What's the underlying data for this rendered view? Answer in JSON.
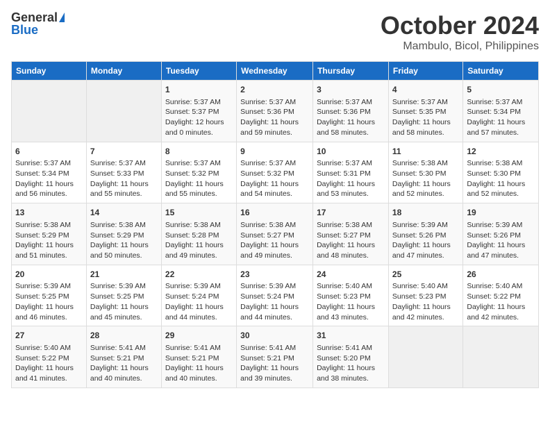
{
  "header": {
    "logo_general": "General",
    "logo_blue": "Blue",
    "month": "October 2024",
    "location": "Mambulo, Bicol, Philippines"
  },
  "days_of_week": [
    "Sunday",
    "Monday",
    "Tuesday",
    "Wednesday",
    "Thursday",
    "Friday",
    "Saturday"
  ],
  "weeks": [
    [
      {
        "day": "",
        "empty": true
      },
      {
        "day": "",
        "empty": true
      },
      {
        "day": "1",
        "sunrise": "Sunrise: 5:37 AM",
        "sunset": "Sunset: 5:37 PM",
        "daylight": "Daylight: 12 hours and 0 minutes."
      },
      {
        "day": "2",
        "sunrise": "Sunrise: 5:37 AM",
        "sunset": "Sunset: 5:36 PM",
        "daylight": "Daylight: 11 hours and 59 minutes."
      },
      {
        "day": "3",
        "sunrise": "Sunrise: 5:37 AM",
        "sunset": "Sunset: 5:36 PM",
        "daylight": "Daylight: 11 hours and 58 minutes."
      },
      {
        "day": "4",
        "sunrise": "Sunrise: 5:37 AM",
        "sunset": "Sunset: 5:35 PM",
        "daylight": "Daylight: 11 hours and 58 minutes."
      },
      {
        "day": "5",
        "sunrise": "Sunrise: 5:37 AM",
        "sunset": "Sunset: 5:34 PM",
        "daylight": "Daylight: 11 hours and 57 minutes."
      }
    ],
    [
      {
        "day": "6",
        "sunrise": "Sunrise: 5:37 AM",
        "sunset": "Sunset: 5:34 PM",
        "daylight": "Daylight: 11 hours and 56 minutes."
      },
      {
        "day": "7",
        "sunrise": "Sunrise: 5:37 AM",
        "sunset": "Sunset: 5:33 PM",
        "daylight": "Daylight: 11 hours and 55 minutes."
      },
      {
        "day": "8",
        "sunrise": "Sunrise: 5:37 AM",
        "sunset": "Sunset: 5:32 PM",
        "daylight": "Daylight: 11 hours and 55 minutes."
      },
      {
        "day": "9",
        "sunrise": "Sunrise: 5:37 AM",
        "sunset": "Sunset: 5:32 PM",
        "daylight": "Daylight: 11 hours and 54 minutes."
      },
      {
        "day": "10",
        "sunrise": "Sunrise: 5:37 AM",
        "sunset": "Sunset: 5:31 PM",
        "daylight": "Daylight: 11 hours and 53 minutes."
      },
      {
        "day": "11",
        "sunrise": "Sunrise: 5:38 AM",
        "sunset": "Sunset: 5:30 PM",
        "daylight": "Daylight: 11 hours and 52 minutes."
      },
      {
        "day": "12",
        "sunrise": "Sunrise: 5:38 AM",
        "sunset": "Sunset: 5:30 PM",
        "daylight": "Daylight: 11 hours and 52 minutes."
      }
    ],
    [
      {
        "day": "13",
        "sunrise": "Sunrise: 5:38 AM",
        "sunset": "Sunset: 5:29 PM",
        "daylight": "Daylight: 11 hours and 51 minutes."
      },
      {
        "day": "14",
        "sunrise": "Sunrise: 5:38 AM",
        "sunset": "Sunset: 5:29 PM",
        "daylight": "Daylight: 11 hours and 50 minutes."
      },
      {
        "day": "15",
        "sunrise": "Sunrise: 5:38 AM",
        "sunset": "Sunset: 5:28 PM",
        "daylight": "Daylight: 11 hours and 49 minutes."
      },
      {
        "day": "16",
        "sunrise": "Sunrise: 5:38 AM",
        "sunset": "Sunset: 5:27 PM",
        "daylight": "Daylight: 11 hours and 49 minutes."
      },
      {
        "day": "17",
        "sunrise": "Sunrise: 5:38 AM",
        "sunset": "Sunset: 5:27 PM",
        "daylight": "Daylight: 11 hours and 48 minutes."
      },
      {
        "day": "18",
        "sunrise": "Sunrise: 5:39 AM",
        "sunset": "Sunset: 5:26 PM",
        "daylight": "Daylight: 11 hours and 47 minutes."
      },
      {
        "day": "19",
        "sunrise": "Sunrise: 5:39 AM",
        "sunset": "Sunset: 5:26 PM",
        "daylight": "Daylight: 11 hours and 47 minutes."
      }
    ],
    [
      {
        "day": "20",
        "sunrise": "Sunrise: 5:39 AM",
        "sunset": "Sunset: 5:25 PM",
        "daylight": "Daylight: 11 hours and 46 minutes."
      },
      {
        "day": "21",
        "sunrise": "Sunrise: 5:39 AM",
        "sunset": "Sunset: 5:25 PM",
        "daylight": "Daylight: 11 hours and 45 minutes."
      },
      {
        "day": "22",
        "sunrise": "Sunrise: 5:39 AM",
        "sunset": "Sunset: 5:24 PM",
        "daylight": "Daylight: 11 hours and 44 minutes."
      },
      {
        "day": "23",
        "sunrise": "Sunrise: 5:39 AM",
        "sunset": "Sunset: 5:24 PM",
        "daylight": "Daylight: 11 hours and 44 minutes."
      },
      {
        "day": "24",
        "sunrise": "Sunrise: 5:40 AM",
        "sunset": "Sunset: 5:23 PM",
        "daylight": "Daylight: 11 hours and 43 minutes."
      },
      {
        "day": "25",
        "sunrise": "Sunrise: 5:40 AM",
        "sunset": "Sunset: 5:23 PM",
        "daylight": "Daylight: 11 hours and 42 minutes."
      },
      {
        "day": "26",
        "sunrise": "Sunrise: 5:40 AM",
        "sunset": "Sunset: 5:22 PM",
        "daylight": "Daylight: 11 hours and 42 minutes."
      }
    ],
    [
      {
        "day": "27",
        "sunrise": "Sunrise: 5:40 AM",
        "sunset": "Sunset: 5:22 PM",
        "daylight": "Daylight: 11 hours and 41 minutes."
      },
      {
        "day": "28",
        "sunrise": "Sunrise: 5:41 AM",
        "sunset": "Sunset: 5:21 PM",
        "daylight": "Daylight: 11 hours and 40 minutes."
      },
      {
        "day": "29",
        "sunrise": "Sunrise: 5:41 AM",
        "sunset": "Sunset: 5:21 PM",
        "daylight": "Daylight: 11 hours and 40 minutes."
      },
      {
        "day": "30",
        "sunrise": "Sunrise: 5:41 AM",
        "sunset": "Sunset: 5:21 PM",
        "daylight": "Daylight: 11 hours and 39 minutes."
      },
      {
        "day": "31",
        "sunrise": "Sunrise: 5:41 AM",
        "sunset": "Sunset: 5:20 PM",
        "daylight": "Daylight: 11 hours and 38 minutes."
      },
      {
        "day": "",
        "empty": true
      },
      {
        "day": "",
        "empty": true
      }
    ]
  ]
}
